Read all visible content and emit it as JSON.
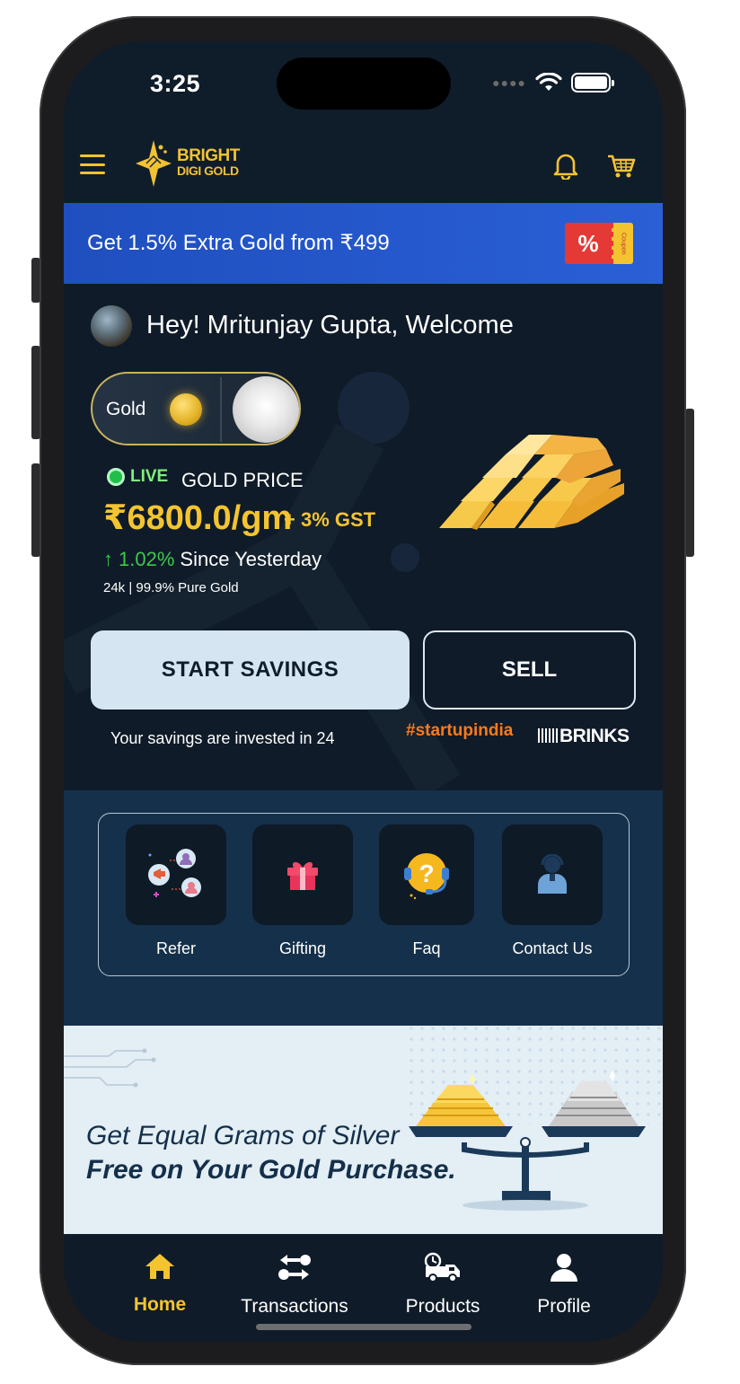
{
  "status_bar": {
    "time": "3:25"
  },
  "header": {
    "logo_line1": "BRIGHT",
    "logo_line2": "DIGI GOLD",
    "icons": [
      "menu-icon",
      "bell-icon",
      "cart-icon"
    ]
  },
  "promo": {
    "text": "Get 1.5% Extra Gold from ₹499",
    "coupon_symbol": "%",
    "coupon_label": "Coupon"
  },
  "welcome": {
    "text": "Hey! Mritunjay Gupta, Welcome"
  },
  "metal_toggle": {
    "selected": "Gold"
  },
  "price": {
    "live_label": "LIVE",
    "label": "GOLD PRICE",
    "value": "₹6800.0/gm",
    "gst": "+ 3% GST",
    "change_arrow": "↑",
    "change_pct": "1.02%",
    "change_label": "Since Yesterday",
    "purity": "24k | 99.9% Pure Gold"
  },
  "actions": {
    "start_label": "START SAVINGS",
    "sell_label": "SELL"
  },
  "trust": {
    "invested_text": "Your savings are invested in 24",
    "startup_text": "#startupindia",
    "brinks_text": "BRINKS"
  },
  "quick_actions": [
    {
      "label": "Refer",
      "icon": "refer-icon"
    },
    {
      "label": "Gifting",
      "icon": "gift-icon"
    },
    {
      "label": "Faq",
      "icon": "faq-icon"
    },
    {
      "label": "Contact Us",
      "icon": "contact-icon"
    }
  ],
  "silver_banner": {
    "line1": "Get Equal Grams of Silver",
    "line2": "Free on Your Gold Purchase."
  },
  "bottom_nav": [
    {
      "label": "Home",
      "icon": "home-icon",
      "active": true
    },
    {
      "label": "Transactions",
      "icon": "transactions-icon"
    },
    {
      "label": "Products",
      "icon": "delivery-truck-icon"
    },
    {
      "label": "Profile",
      "icon": "profile-icon"
    }
  ],
  "colors": {
    "accent_gold": "#f4c430",
    "background": "#0f1b28",
    "promo_blue": "#2a5fd6",
    "quick_section": "#15304a",
    "positive_green": "#3ec74f"
  }
}
